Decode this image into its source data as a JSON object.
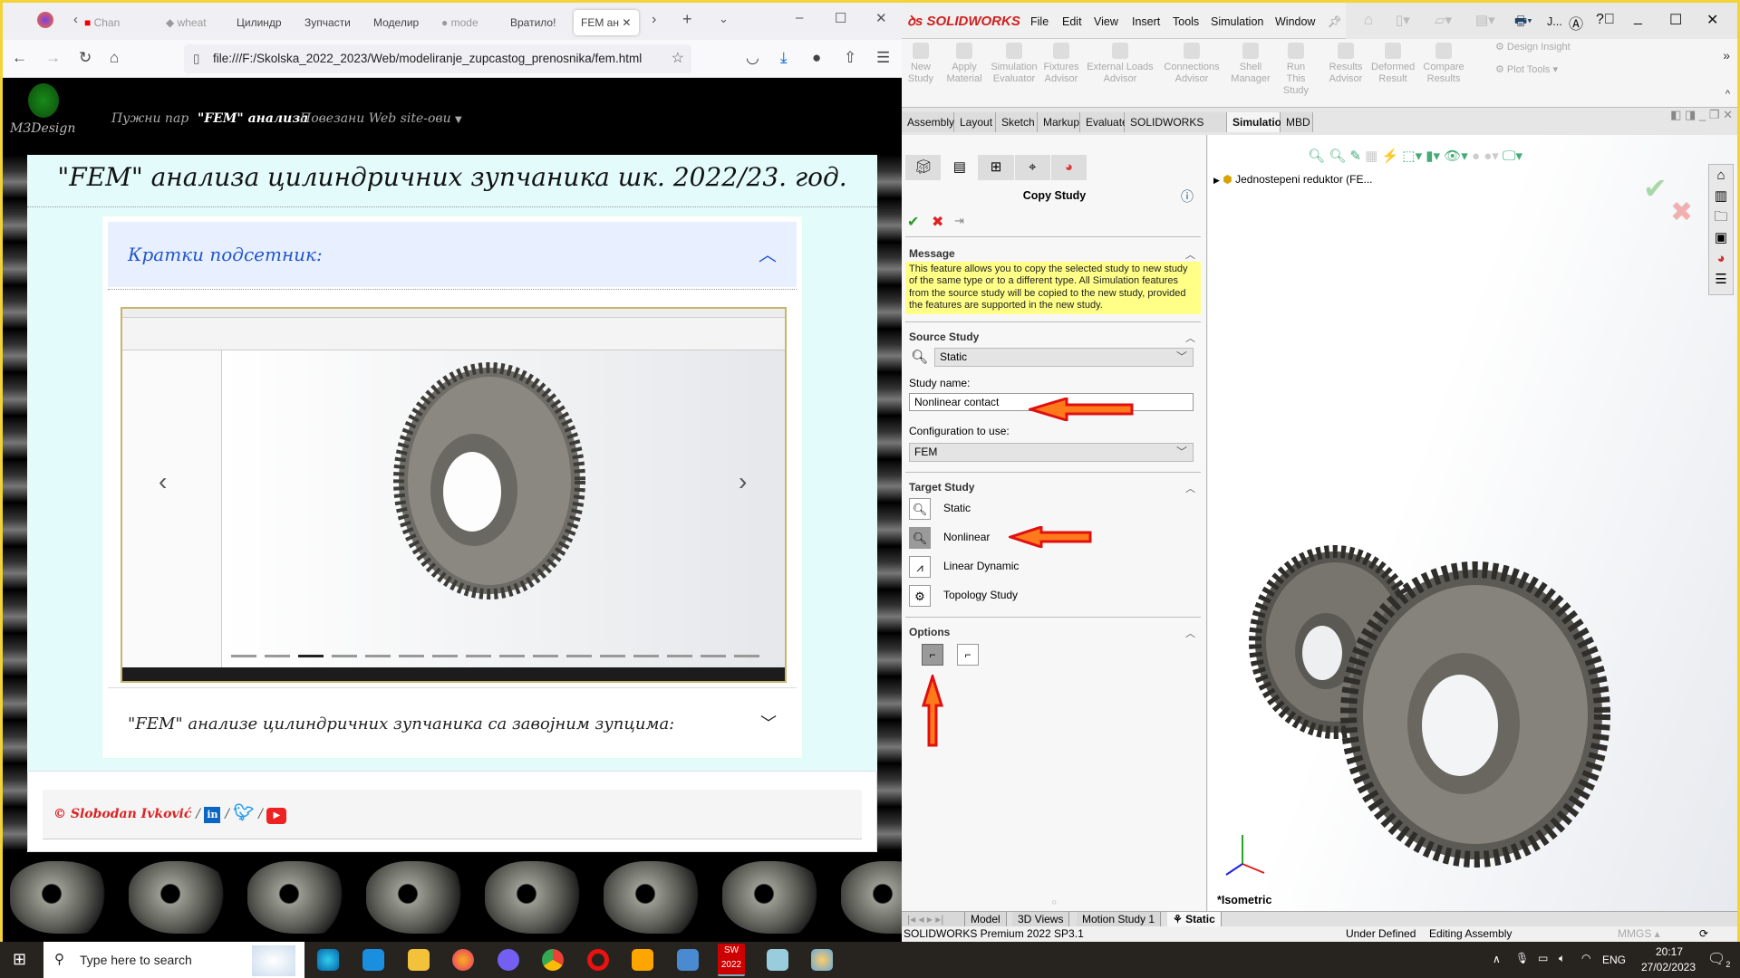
{
  "browser": {
    "tabs": [
      "Chan",
      "wheat",
      "Цилиндр",
      "Зупчасти",
      "Моделир",
      "mode",
      "Вратило!",
      "FEM ан"
    ],
    "url": "file:///F:/Skolska_2022_2023/Web/modeliranje_zupcastog_prenosnika/fem.html"
  },
  "web": {
    "logo": "M3Design",
    "nav": [
      "Пужни пар",
      "\"FEM\" анализа",
      "Повезани Web site-ови"
    ],
    "title": "\"FEM\" анализа цилиндричних зупчаника шк. 2022/23. год.",
    "accordion1": "Кратки подсетник:",
    "accordion2": "\"FEM\" анализе цилиндричних зупчаника са завојним зупцима:",
    "footer": "© Slobodan Ivković",
    "social": [
      "in",
      "twitter",
      "youtube"
    ],
    "slide_count": 16,
    "active_slide": 2
  },
  "solidworks": {
    "brand": "SOLIDWORKS",
    "menu": [
      "File",
      "Edit",
      "View",
      "Insert",
      "Tools",
      "Simulation",
      "Window"
    ],
    "user": "J...",
    "ribbon": [
      "New Study",
      "Apply Material",
      "Simulation Evaluator",
      "Fixtures Advisor",
      "External Loads Advisor",
      "Connections Advisor",
      "Shell Manager",
      "Run This Study",
      "Results Advisor",
      "Deformed Result",
      "Compare Results"
    ],
    "ribbon_side": [
      "Design Insight",
      "Plot Tools"
    ],
    "cm_tabs": [
      "Assembly",
      "Layout",
      "Sketch",
      "Markup",
      "Evaluate",
      "SOLIDWORKS Add-Ins",
      "Simulation",
      "MBD"
    ],
    "active_cm_tab": "Simulation",
    "pm": {
      "title": "Copy Study",
      "message_header": "Message",
      "message": "This feature allows you to copy the selected study to new study of the same type or to a different type. All Simulation features from the source study will be copied to the new study, provided the features are supported in the new study.",
      "source_header": "Source Study",
      "source_value": "Static",
      "study_name_label": "Study name:",
      "study_name_value": "Nonlinear contact",
      "config_label": "Configuration to use:",
      "config_value": "FEM",
      "target_header": "Target Study",
      "targets": [
        "Static",
        "Nonlinear",
        "Linear Dynamic",
        "Topology Study"
      ],
      "selected_target": "Nonlinear",
      "options_header": "Options"
    },
    "tree_item": "Jednostepeni reduktor (FE...",
    "view_label": "*Isometric",
    "bottom_tabs": [
      "Model",
      "3D Views",
      "Motion Study 1",
      "Static"
    ],
    "status": {
      "product": "SOLIDWORKS Premium 2022 SP3.1",
      "state1": "Under Defined",
      "state2": "Editing Assembly",
      "units": "MMGS"
    },
    "colors": {
      "accent_red": "#e02020",
      "arrow_orange": "#ff7a1a",
      "message_bg": "#ffff88"
    }
  },
  "taskbar": {
    "search_placeholder": "Type here to search",
    "lang": "ENG",
    "time": "20:17",
    "date": "27/02/2023",
    "notifications": "2"
  }
}
